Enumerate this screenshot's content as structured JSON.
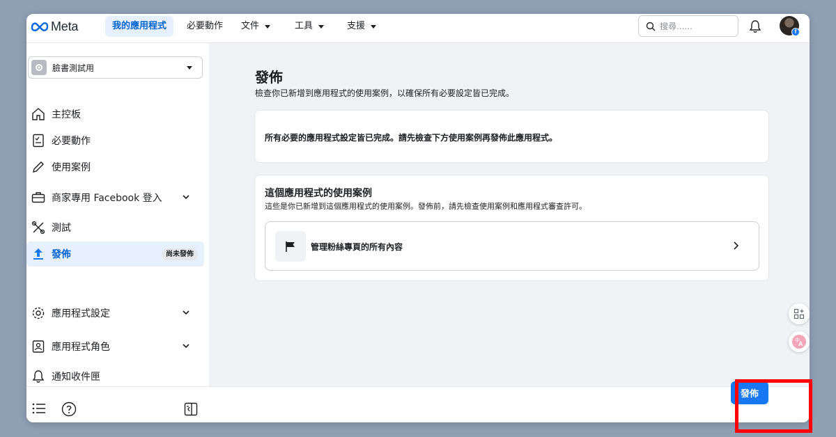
{
  "brand": {
    "logo_text": "Meta"
  },
  "top_nav": {
    "items": [
      {
        "label": "我的應用程式"
      },
      {
        "label": "必要動作"
      },
      {
        "label": "文件"
      },
      {
        "label": "工具"
      },
      {
        "label": "支援"
      }
    ],
    "search_placeholder": "搜尋......"
  },
  "sidebar": {
    "app_name": "臉書測試用",
    "items": [
      {
        "label": "主控板"
      },
      {
        "label": "必要動作"
      },
      {
        "label": "使用案例"
      },
      {
        "label": "商家專用 Facebook 登入"
      },
      {
        "label": "測試"
      },
      {
        "label": "發佈",
        "badge": "尚未發佈"
      },
      {
        "label": "應用程式設定"
      },
      {
        "label": "應用程式角色"
      },
      {
        "label": "通知收件匣"
      }
    ]
  },
  "main": {
    "title": "發佈",
    "subtitle": "檢查你已新增到應用程式的使用案例，以確保所有必要設定皆已完成。",
    "status_message": "所有必要的應用程式設定皆已完成。請先檢查下方使用案例再發佈此應用程式。",
    "use_cases": {
      "heading": "這個應用程式的使用案例",
      "description": "這些是你已新增到這個應用程式的使用案例。發佈前，請先檢查使用案例和應用程式審查許可。",
      "items": [
        {
          "label": "管理粉絲專頁的所有內容"
        }
      ]
    }
  },
  "footer": {
    "publish_label": "發佈"
  },
  "colors": {
    "accent": "#1877f2",
    "highlight": "#ff0000",
    "active_bg": "#e7f0fd"
  }
}
